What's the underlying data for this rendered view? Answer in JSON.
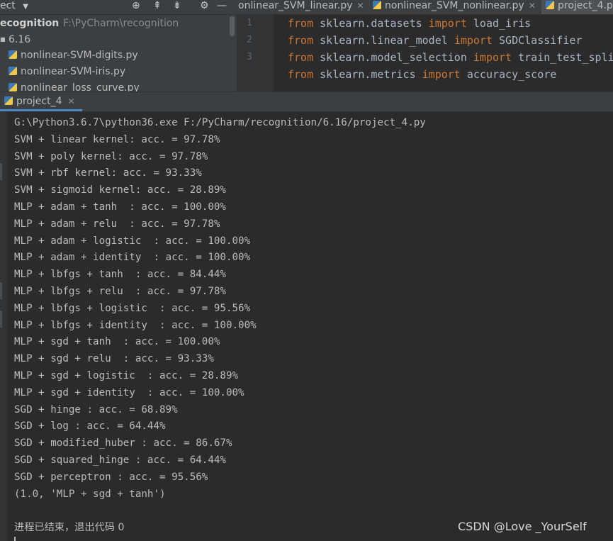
{
  "toolbar": {
    "project_label": "ect",
    "tabs": [
      {
        "label": "onlinear_SVM_linear.py"
      },
      {
        "label": "nonlinear_SVM_nonlinear.py"
      },
      {
        "label": "project_4.p"
      }
    ]
  },
  "project_tree": {
    "root_name": "ecognition",
    "root_path": "F:\\PyCharm\\recognition",
    "folder": "6.16",
    "files": [
      "nonlinear-SVM-digits.py",
      "nonlinear-SVM-iris.py",
      "nonlinear_loss_curve.py"
    ]
  },
  "editor": {
    "lines": [
      {
        "num": "1",
        "kw1": "from",
        "mod": " sklearn.datasets ",
        "kw2": "import",
        "name": " load_iris"
      },
      {
        "num": "2",
        "kw1": "from",
        "mod": " sklearn.linear_model ",
        "kw2": "import",
        "name": " SGDClassifier"
      },
      {
        "num": "3",
        "kw1": "from",
        "mod": " sklearn.model_selection ",
        "kw2": "import",
        "name": " train_test_split"
      },
      {
        "num": "",
        "kw1": "from",
        "mod": " sklearn.metrics ",
        "kw2": "import",
        "name": " accuracy_score"
      }
    ]
  },
  "run": {
    "tab_label": "project_4",
    "console_lines": [
      "G:\\Python3.6.7\\python36.exe F:/PyCharm/recognition/6.16/project_4.py",
      "SVM + linear kernel: acc. = 97.78%",
      "SVM + poly kernel: acc. = 97.78%",
      "SVM + rbf kernel: acc. = 93.33%",
      "SVM + sigmoid kernel: acc. = 28.89%",
      "MLP + adam + tanh  : acc. = 100.00%",
      "MLP + adam + relu  : acc. = 97.78%",
      "MLP + adam + logistic  : acc. = 100.00%",
      "MLP + adam + identity  : acc. = 100.00%",
      "MLP + lbfgs + tanh  : acc. = 84.44%",
      "MLP + lbfgs + relu  : acc. = 97.78%",
      "MLP + lbfgs + logistic  : acc. = 95.56%",
      "MLP + lbfgs + identity  : acc. = 100.00%",
      "MLP + sgd + tanh  : acc. = 100.00%",
      "MLP + sgd + relu  : acc. = 93.33%",
      "MLP + sgd + logistic  : acc. = 28.89%",
      "MLP + sgd + identity  : acc. = 100.00%",
      "SGD + hinge : acc. = 68.89%",
      "SGD + log : acc. = 64.44%",
      "SGD + modified_huber : acc. = 86.67%",
      "SGD + squared_hinge : acc. = 64.44%",
      "SGD + perceptron : acc. = 95.56%",
      "(1.0, 'MLP + sgd + tanh')"
    ],
    "exit_message": "进程已结束，退出代码 0"
  },
  "watermark": "CSDN @Love _YourSelf",
  "colors": {
    "keyword": "#cc7832",
    "accent": "#4a88c7",
    "background": "#2b2b2b"
  }
}
